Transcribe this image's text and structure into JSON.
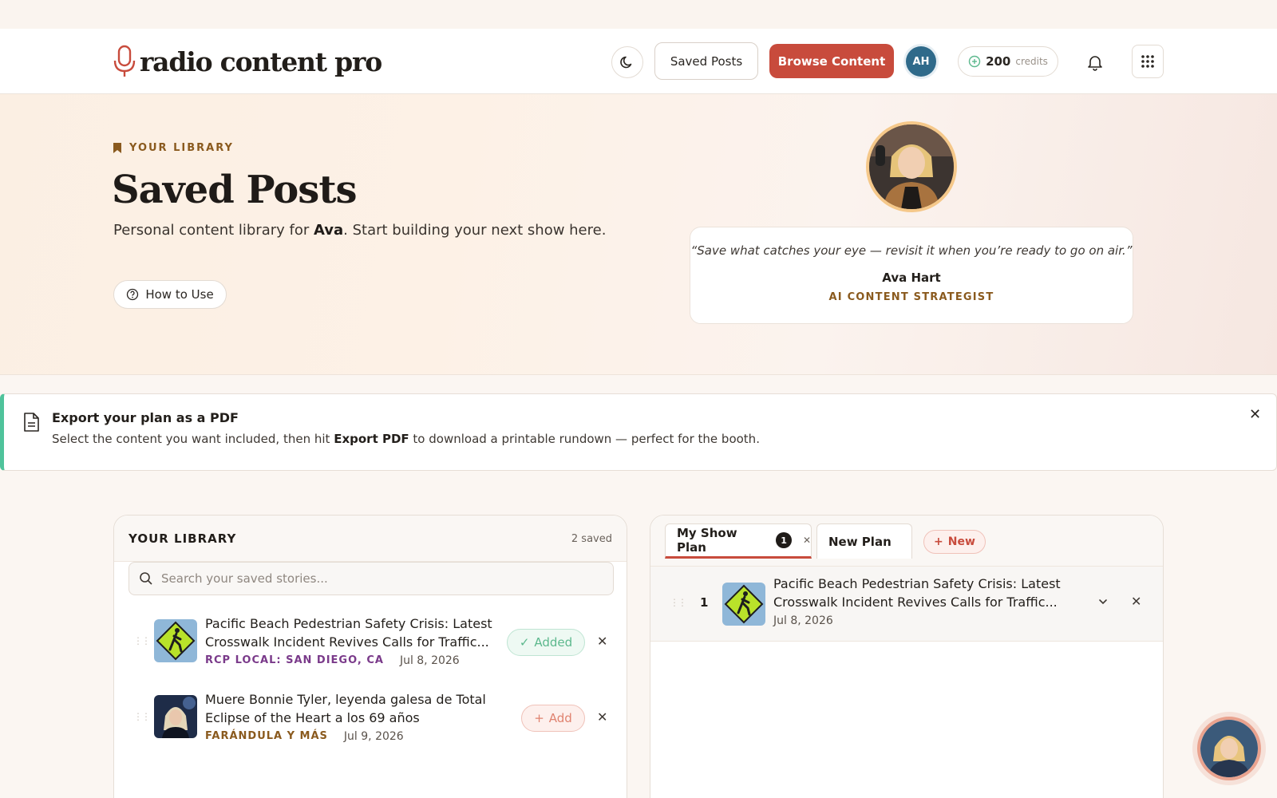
{
  "header": {
    "logo_text": "radio content pro",
    "theme_icon": "moon-icon",
    "saved_posts_label": "Saved Posts",
    "browse_label": "Browse Content",
    "avatar_initials": "AH",
    "credits_count": "200",
    "credits_label": "credits",
    "bell_icon": "bell-icon",
    "apps_icon": "grid-icon"
  },
  "hero": {
    "eyebrow": "YOUR LIBRARY",
    "title": "Saved Posts",
    "subtitle_prefix": "Personal content library for ",
    "subtitle_name": "Ava",
    "subtitle_suffix": ". Start building your next show here.",
    "how_to_label": "How to Use",
    "quote": "“Save what catches your eye — revisit it when you’re ready to go on air.”",
    "quote_name": "Ava Hart",
    "quote_role": "AI CONTENT STRATEGIST"
  },
  "banner": {
    "title": "Export your plan as a PDF",
    "desc_prefix": "Select the content you want included, then hit ",
    "desc_bold": "Export PDF",
    "desc_suffix": " to download a printable rundown — perfect for the booth.",
    "accent_color": "#4fc39b"
  },
  "library": {
    "title": "YOUR LIBRARY",
    "count": "2 saved",
    "search_placeholder": "Search your saved stories...",
    "items": [
      {
        "title": "Pacific Beach Pedestrian Safety Crisis: Latest Crosswalk Incident Revives Calls for Traffic...",
        "source": "RCP LOCAL: SAN DIEGO, CA",
        "source_color": "#7a3a8a",
        "date": "Jul 8, 2026",
        "action": "Added"
      },
      {
        "title": "Muere Bonnie Tyler, leyenda galesa de Total Eclipse of the Heart a los 69 años",
        "source": "FARÁNDULA Y MÁS",
        "source_color": "#8a5a1e",
        "date": "Jul 9, 2026",
        "action": "Add"
      }
    ]
  },
  "plan": {
    "tabs": [
      {
        "label": "My Show Plan",
        "badge": "1"
      },
      {
        "label": "New Plan"
      }
    ],
    "new_label": "New",
    "items": [
      {
        "number": "1",
        "title": "Pacific Beach Pedestrian Safety Crisis: Latest Crosswalk Incident Revives Calls for Traffic...",
        "date": "Jul 8, 2026"
      }
    ]
  },
  "colors": {
    "brand": "#c84b3c",
    "avatar_bg": "#2f6a8a",
    "gold": "#8a5a1e"
  }
}
